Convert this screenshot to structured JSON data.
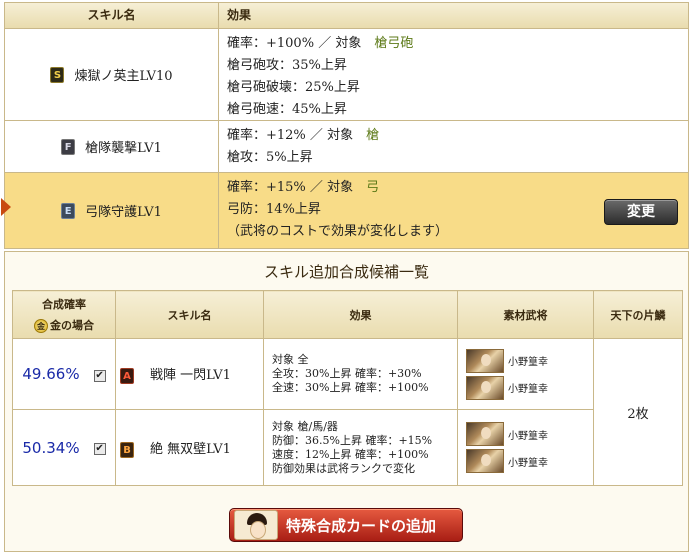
{
  "skills_table": {
    "headers": {
      "name": "スキル名",
      "effect": "効果"
    },
    "rows": [
      {
        "rank": "S",
        "name": "煉獄ノ英主LV10",
        "prob_text": "確率：+100%",
        "target_label": "対象",
        "target": "槍弓砲",
        "lines": [
          "槍弓砲攻：35%上昇",
          "槍弓砲破壊：25%上昇",
          "槍弓砲速：45%上昇"
        ]
      },
      {
        "rank": "F",
        "name": "槍隊襲撃LV1",
        "prob_text": "確率：+12%",
        "target_label": "対象",
        "target": "槍",
        "lines": [
          "槍攻：5%上昇"
        ]
      },
      {
        "rank": "E",
        "name": "弓隊守護LV1",
        "prob_text": "確率：+15%",
        "target_label": "対象",
        "target": "弓",
        "lines": [
          "弓防：14%上昇",
          "（武将のコストで効果が変化します）"
        ],
        "button": "変更"
      }
    ]
  },
  "candidates": {
    "title": "スキル追加合成候補一覧",
    "headers": {
      "rate": "合成確率",
      "gold_chip": "金",
      "gold_case": "金の場合",
      "skill": "スキル名",
      "effect": "効果",
      "material": "素材武将",
      "tenka": "天下の片鱗"
    },
    "tenka_value": "2枚",
    "rows": [
      {
        "rate": "49.66%",
        "checked": "✔",
        "rank": "A",
        "skill": "戦陣 一閃LV1",
        "effect_lines": [
          "対象  全",
          "全攻：30%上昇  確率：+30%",
          "全速：30%上昇  確率：+100%"
        ],
        "generals": [
          "小野篁幸",
          "小野篁幸"
        ]
      },
      {
        "rate": "50.34%",
        "checked": "✔",
        "rank": "B",
        "skill": "絶 無双壁LV1",
        "effect_lines": [
          "対象  槍/馬/器",
          "防御：36.5%上昇  確率：+15%",
          "速度：12%上昇  確率：+100%",
          "防御効果は武将ランクで変化"
        ],
        "generals": [
          "小野篁幸",
          "小野篁幸"
        ]
      }
    ]
  },
  "special_button": {
    "label": "特殊合成カードの追加",
    "icon": "portrait-icon"
  },
  "colors": {
    "active_row": "#f8dc88",
    "target_green": "#5d7a18",
    "rate_blue": "#1a2aa8",
    "button_red": "#a81e14"
  }
}
